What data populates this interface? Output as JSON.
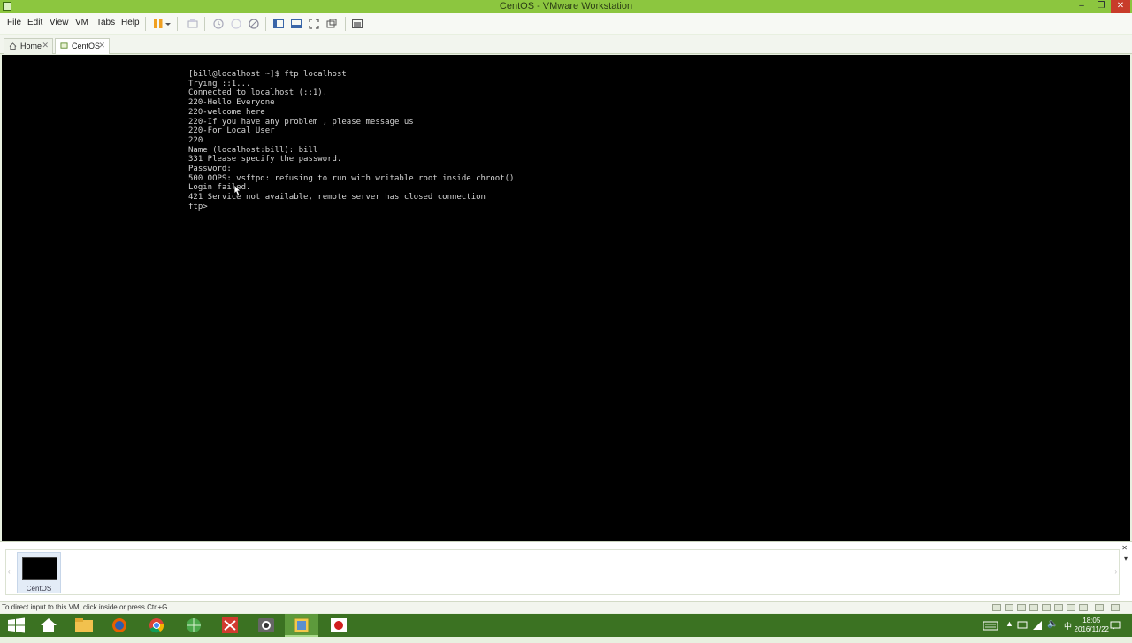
{
  "window": {
    "title": "CentOS - VMware Workstation",
    "minimize_icon": "minimize-icon",
    "restore_icon": "restore-icon",
    "close_icon": "close-icon"
  },
  "menu": {
    "items": [
      "File",
      "Edit",
      "View",
      "VM",
      "Tabs",
      "Help"
    ]
  },
  "toolbar": {
    "icons": [
      "pause-icon",
      "dropdown-arrow-icon",
      "send-ctrl-alt-del-icon",
      "snapshot-icon",
      "revert-snapshot-icon",
      "snapshot-manager-icon",
      "show-library-icon",
      "thumbnail-bar-icon",
      "full-screen-icon",
      "unity-icon",
      "console-view-icon"
    ]
  },
  "tabs": [
    {
      "label": "Home",
      "icon": "home-icon",
      "active": false
    },
    {
      "label": "CentOS",
      "icon": "vm-icon",
      "active": true
    }
  ],
  "console": {
    "lines": [
      "[bill@localhost ~]$ ftp localhost",
      "Trying ::1...",
      "Connected to localhost (::1).",
      "220-Hello Everyone",
      "220-welcome here",
      "220-If you have any problem , please message us",
      "220-For Local User",
      "220",
      "Name (localhost:bill): bill",
      "331 Please specify the password.",
      "Password:",
      "500 OOPS: vsftpd: refusing to run with writable root inside chroot()",
      "Login failed.",
      "421 Service not available, remote server has closed connection",
      "ftp>"
    ]
  },
  "thumbnail_bar": {
    "vm_label": "CentOS"
  },
  "status": {
    "text": "To direct input to this VM, click inside or press Ctrl+G."
  },
  "taskbar": {
    "apps": [
      "windows-start-icon",
      "home-icon",
      "file-explorer-icon",
      "firefox-icon",
      "chrome-icon",
      "network-globe-icon",
      "media-app-icon",
      "camera-app-icon",
      "vmware-icon",
      "video-recorder-icon"
    ],
    "clock_time": "18:05",
    "clock_date": "2016/11/22"
  },
  "colors": {
    "titlebar": "#8cc63f",
    "taskbar": "#3b7222",
    "console_bg": "#000000",
    "console_text": "#d4d4d4"
  }
}
